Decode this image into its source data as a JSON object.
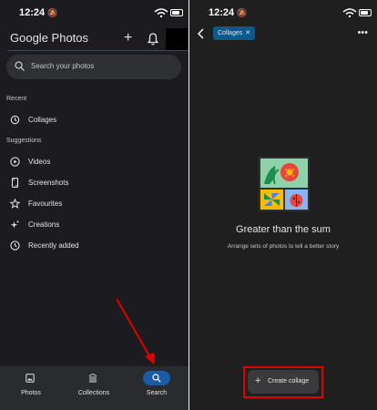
{
  "left_screen": {
    "status": {
      "time": "12:24"
    },
    "header": {
      "brand": "Google",
      "product": "Photos",
      "add_label": "+"
    },
    "search": {
      "placeholder": "Search your photos"
    },
    "recent": {
      "title": "Recent",
      "items": [
        {
          "label": "Collages",
          "icon": "history-icon"
        }
      ]
    },
    "suggestions": {
      "title": "Suggestions",
      "items": [
        {
          "label": "Videos",
          "icon": "play-circle-icon"
        },
        {
          "label": "Screenshots",
          "icon": "phone-screenshot-icon"
        },
        {
          "label": "Favourites",
          "icon": "star-icon"
        },
        {
          "label": "Creations",
          "icon": "sparkle-icon"
        },
        {
          "label": "Recently added",
          "icon": "clock-icon"
        }
      ]
    },
    "bottom_nav": {
      "items": [
        {
          "label": "Photos",
          "icon": "image-icon"
        },
        {
          "label": "Collections",
          "icon": "library-icon"
        },
        {
          "label": "Search",
          "icon": "search-icon",
          "active": true
        }
      ]
    }
  },
  "right_screen": {
    "status": {
      "time": "12:24"
    },
    "chip": {
      "label": "Collages",
      "close": "✕"
    },
    "menu": {
      "label": "•••"
    },
    "empty_state": {
      "heading": "Greater than the sum",
      "description": "Arrange sets of photos to tell a better story"
    },
    "create_button": {
      "icon": "+",
      "label": "Create collage"
    }
  },
  "colors": {
    "accent": "#1a5ca4",
    "chip": "#0b5b8c",
    "annotation": "#e00000"
  }
}
